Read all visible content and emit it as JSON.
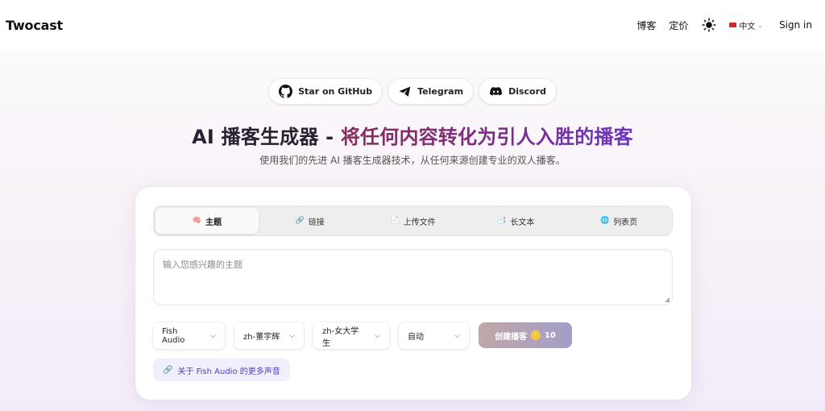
{
  "header": {
    "logo": "Twocast",
    "nav_blog": "博客",
    "nav_pricing": "定价",
    "theme_icon": "sun-icon",
    "language": "中文",
    "sign_in": "Sign in"
  },
  "links": {
    "github": "Star on GitHub",
    "telegram": "Telegram",
    "discord": "Discord"
  },
  "hero": {
    "title_part1": "AI 播客生成器 - ",
    "title_part2": "将任何内容转化为引人入胜的播客",
    "subtitle": "使用我们的先进 AI 播客生成器技术，从任何来源创建专业的双人播客。"
  },
  "tabs": [
    {
      "icon": "🧠",
      "label": "主题",
      "active": true
    },
    {
      "icon": "🔗",
      "label": "链接",
      "active": false
    },
    {
      "icon": "📄",
      "label": "上传文件",
      "active": false
    },
    {
      "icon": "📑",
      "label": "长文本",
      "active": false
    },
    {
      "icon": "🌐",
      "label": "列表页",
      "active": false
    }
  ],
  "input": {
    "placeholder": "输入您感兴趣的主题"
  },
  "controls": {
    "provider": "Fish Audio",
    "voice1": "zh-董宇辉",
    "voice2": "zh-女大学生",
    "mode": "自动",
    "create_label": "创建播客",
    "create_cost": "10"
  },
  "more_voices": "关于 Fish Audio 的更多声音",
  "colors": {
    "accent_gradient_start": "#8a2c5a",
    "accent_gradient_end": "#6a35c2",
    "link_color": "#4a44b8"
  }
}
